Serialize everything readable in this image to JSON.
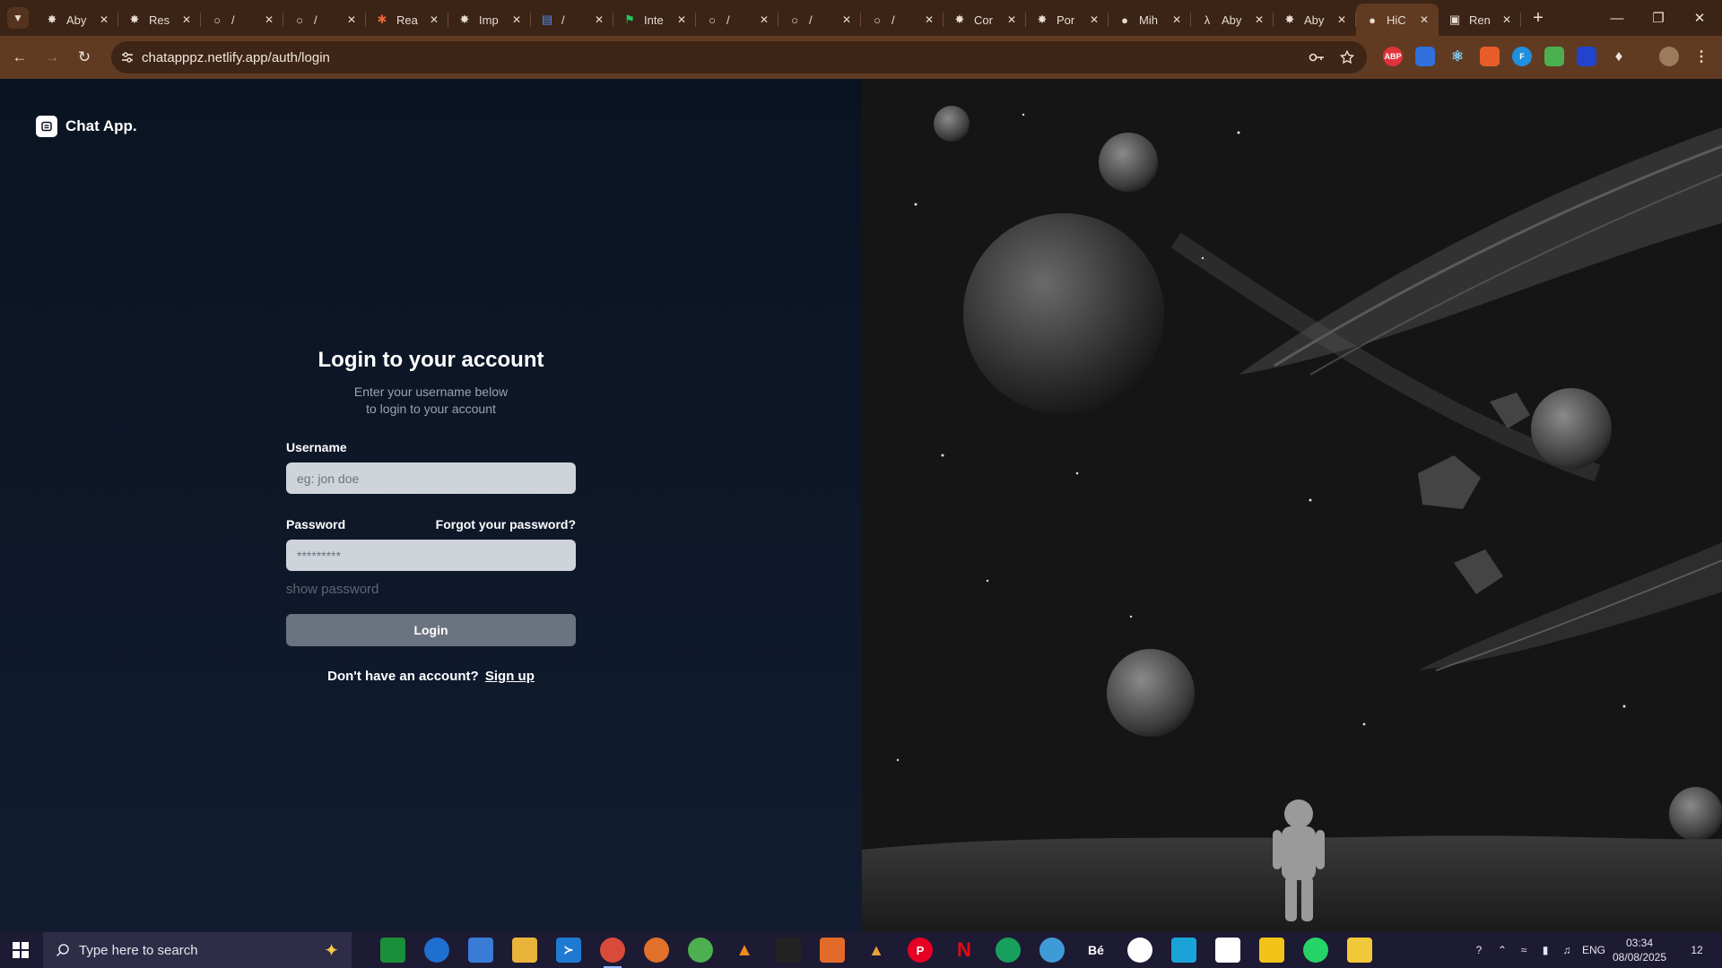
{
  "browser": {
    "tabs": [
      {
        "label": "Aby",
        "icon": "chatgpt-icon"
      },
      {
        "label": "Res",
        "icon": "chatgpt-icon"
      },
      {
        "label": "/",
        "icon": "globe-icon"
      },
      {
        "label": "/",
        "icon": "globe-icon"
      },
      {
        "label": "Rea",
        "icon": "asterisk-icon"
      },
      {
        "label": "Imp",
        "icon": "chatgpt-icon"
      },
      {
        "label": "/",
        "icon": "docs-icon"
      },
      {
        "label": "Inte",
        "icon": "flag-icon"
      },
      {
        "label": "/",
        "icon": "globe-icon"
      },
      {
        "label": "/",
        "icon": "globe-icon"
      },
      {
        "label": "/",
        "icon": "globe-icon"
      },
      {
        "label": "Cor",
        "icon": "chatgpt-icon"
      },
      {
        "label": "Por",
        "icon": "chatgpt-icon"
      },
      {
        "label": "Mih",
        "icon": "github-icon"
      },
      {
        "label": "Aby",
        "icon": "leetcode-icon"
      },
      {
        "label": "Aby",
        "icon": "chatgpt-icon"
      },
      {
        "label": "HiC",
        "icon": "chat-bubbles-icon",
        "active": true
      },
      {
        "label": "Ren",
        "icon": "page-icon"
      }
    ],
    "url": "chatapppz.netlify.app/auth/login",
    "colors": {
      "frame": "#3b2415",
      "toolbar": "#603b22"
    }
  },
  "app": {
    "brand_name": "Chat App."
  },
  "login": {
    "title": "Login to your account",
    "subtitle_line1": "Enter your username below",
    "subtitle_line2": "to login to your account",
    "username_label": "Username",
    "username_placeholder": "eg: jon doe",
    "password_label": "Password",
    "forgot_link": "Forgot your password?",
    "password_placeholder": "*********",
    "show_password": "show password",
    "login_button": "Login",
    "signup_prompt": "Don't have an account?",
    "signup_link": "Sign up"
  },
  "taskbar": {
    "search_placeholder": "Type here to search",
    "language": "ENG",
    "time": "03:34",
    "date": "08/08/2025",
    "notifications": "12"
  }
}
